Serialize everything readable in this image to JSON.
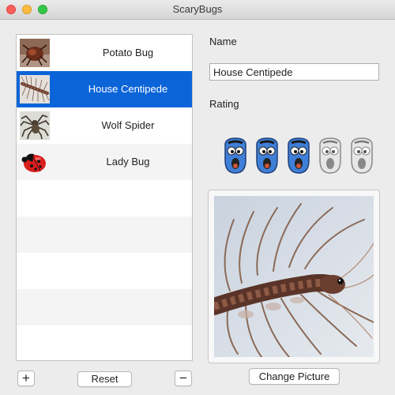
{
  "window": {
    "title": "ScaryBugs"
  },
  "bugs": [
    {
      "name": "Potato Bug",
      "icon": "potato-bug-thumb"
    },
    {
      "name": "House Centipede",
      "icon": "centipede-thumb"
    },
    {
      "name": "Wolf Spider",
      "icon": "wolf-spider-thumb"
    },
    {
      "name": "Lady Bug",
      "icon": "lady-bug-thumb"
    }
  ],
  "selected_index": 1,
  "buttons": {
    "add": "+",
    "reset": "Reset",
    "remove": "−",
    "change_picture": "Change Picture"
  },
  "detail": {
    "name_label": "Name",
    "name_value": "House Centipede",
    "rating_label": "Rating",
    "rating": 3,
    "rating_max": 5,
    "rating_icon": "scared-face-icon"
  },
  "colors": {
    "selection": "#0b64d8",
    "face_active": "#3f7fd8",
    "face_inactive": "#e6e6e6"
  }
}
